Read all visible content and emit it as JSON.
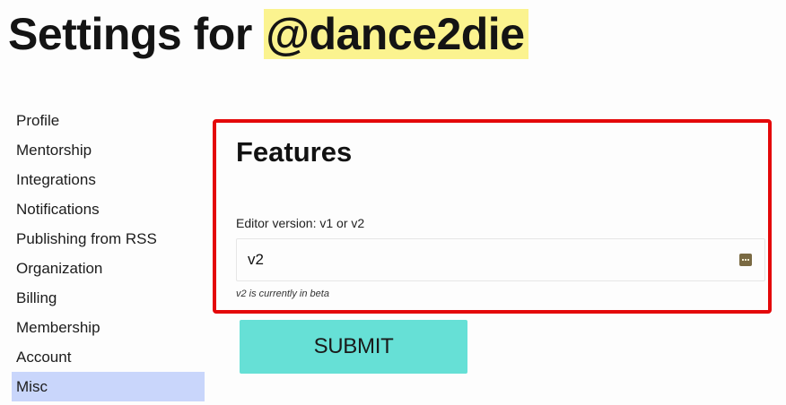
{
  "page": {
    "title_prefix": "Settings for ",
    "username": "@dance2die"
  },
  "sidebar": {
    "items": [
      {
        "label": "Profile",
        "active": false
      },
      {
        "label": "Mentorship",
        "active": false
      },
      {
        "label": "Integrations",
        "active": false
      },
      {
        "label": "Notifications",
        "active": false
      },
      {
        "label": "Publishing from RSS",
        "active": false
      },
      {
        "label": "Organization",
        "active": false
      },
      {
        "label": "Billing",
        "active": false
      },
      {
        "label": "Membership",
        "active": false
      },
      {
        "label": "Account",
        "active": false
      },
      {
        "label": "Misc",
        "active": true
      }
    ]
  },
  "features": {
    "heading": "Features",
    "editor_label": "Editor version: v1 or v2",
    "editor_value": "v2",
    "help_text": "v2 is currently in beta",
    "select_icon": "select-dropdown-icon"
  },
  "actions": {
    "submit_label": "SUBMIT"
  },
  "colors": {
    "username_highlight": "#fbf38f",
    "active_nav": "#c9d6fb",
    "highlight_frame": "#e4080a",
    "submit_button": "#66e0d6"
  }
}
